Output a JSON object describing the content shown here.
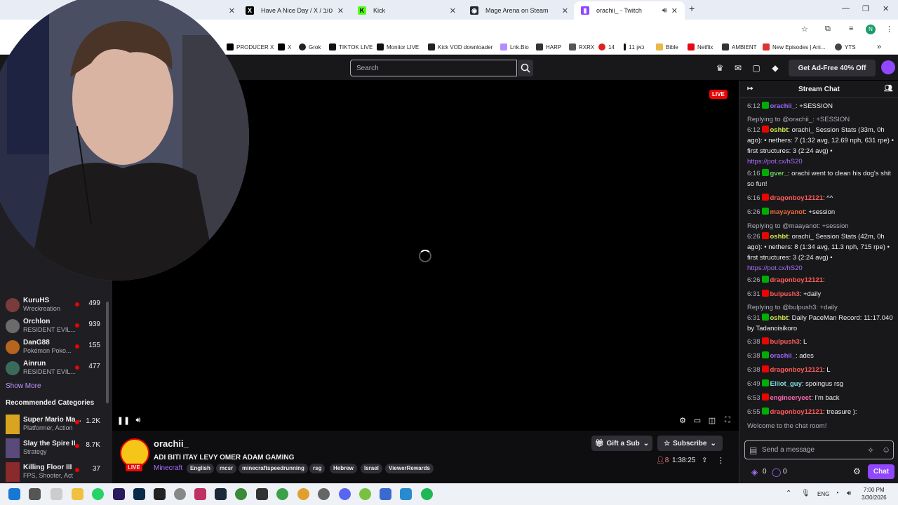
{
  "browser": {
    "tabs": [
      {
        "label": "",
        "icon": "blank-icon"
      },
      {
        "label": "Have A Nice Day / X / יום טוב",
        "icon": "x-icon"
      },
      {
        "label": "Kick",
        "icon": "kick-icon"
      },
      {
        "label": "Mage Arena on Steam",
        "icon": "steam-icon"
      },
      {
        "label": "orachii_ - Twitch",
        "icon": "twitch-icon"
      }
    ],
    "new_tab": "+",
    "bookmarks": [
      "PRODUCER X",
      "X",
      "Grok",
      "TIKTOK LIVE",
      "Monitor LIVE",
      "Kick VOD downloader",
      "Lnk.Bio",
      "HARP",
      "RXRX",
      "14",
      "כאן 11",
      "Bible",
      "Netflix",
      "AMBIENT",
      "New Episodes | Ani...",
      "YTS"
    ],
    "profile_initial": "N"
  },
  "twitch": {
    "search_placeholder": "Search",
    "adfree_label": "Get Ad-Free 40% Off"
  },
  "sidebar": {
    "channels": [
      {
        "name": "KuruHS",
        "game": "Wreckreation",
        "viewers": "499",
        "color": "#7a3b3b"
      },
      {
        "name": "Orchlon",
        "game": "RESIDENT EVIL...",
        "viewers": "939",
        "color": "#6b6b6b"
      },
      {
        "name": "DanG88",
        "game": "Pokémon Poko...",
        "viewers": "155",
        "color": "#b5651d"
      },
      {
        "name": "Ainrun",
        "game": "RESIDENT EVIL...",
        "viewers": "477",
        "color": "#3a6b5a"
      }
    ],
    "show_more": "Show More",
    "rec_heading": "Recommended Categories",
    "categories": [
      {
        "name": "Super Mario Ma...",
        "tags": "Platformer, Action",
        "viewers": "1.2K",
        "color": "#d9a520"
      },
      {
        "name": "Slay the Spire II",
        "tags": "Strategy",
        "viewers": "8.7K",
        "color": "#5a4a7a"
      },
      {
        "name": "Killing Floor III",
        "tags": "FPS, Shooter, Act",
        "viewers": "37",
        "color": "#8a2a2a"
      }
    ]
  },
  "player": {
    "live_badge": "LIVE"
  },
  "stream": {
    "streamer": "orachii_",
    "live": "LIVE",
    "title": "ADI BITI ITAY LEVY OMER ADAM GAMING",
    "game": "Minecraft",
    "tags": [
      "English",
      "mcsr",
      "minecraftspeedrunning",
      "rsg",
      "Hebrew",
      "Israel",
      "ViewerRewards"
    ],
    "gift_sub": "Gift a Sub",
    "subscribe": "Subscribe",
    "viewers": "8",
    "uptime": "1:38:25"
  },
  "chat": {
    "header": "Stream Chat",
    "messages": [
      {
        "reply": "",
        "time": "6:12",
        "user": "orachii_",
        "color": "#9b6bff",
        "text": ": +SESSION"
      },
      {
        "reply": "Replying to @orachii_: +SESSION",
        "time": "6:12",
        "user": "oshbt",
        "color": "#d0e84f",
        "text": ": orachi_ Session Stats (33m, 0h ago): • nethers: 7 (1:32 avg, 12.69 nph, 631 rpe) • first structures: 3 (2:24 avg) •",
        "link": "https://pot.cx/hS20"
      },
      {
        "reply": "",
        "time": "6:16",
        "user": "gver_",
        "color": "#6ad15a",
        "text": ": orachi went to clean his dog's shit so fun!"
      },
      {
        "reply": "",
        "time": "6:16",
        "user": "dragonboy12121",
        "color": "#ff5a5a",
        "text": ": ^^"
      },
      {
        "reply": "",
        "time": "6:26",
        "user": "mayayanot",
        "color": "#e86a3a",
        "text": ": +session"
      },
      {
        "reply": "Replying to @maayanot: +session",
        "time": "6:26",
        "user": "oshbt",
        "color": "#d0e84f",
        "text": ": orachi_ Session Stats (42m, 0h ago): • nethers: 8 (1:34 avg, 11.3 nph, 715 rpe) • first structures: 3 (2:24 avg) •",
        "link": "https://pot.cx/hS20"
      },
      {
        "reply": "",
        "time": "6:26",
        "user": "dragonboy12121",
        "color": "#ff5a5a",
        "text": ":"
      },
      {
        "reply": "",
        "time": "6:31",
        "user": "bulpush3",
        "color": "#ff5a5a",
        "text": ": +daily"
      },
      {
        "reply": "Replying to @bulpush3: +daily",
        "time": "6:31",
        "user": "oshbt",
        "color": "#d0e84f",
        "text": ": Daily PaceMan Record: 11:17.040 by Tadanoisikoro"
      },
      {
        "reply": "",
        "time": "6:38",
        "user": "bulpush3",
        "color": "#ff5a5a",
        "text": ": L"
      },
      {
        "reply": "",
        "time": "6:38",
        "user": "orachii_",
        "color": "#9b6bff",
        "text": ": ades"
      },
      {
        "reply": "",
        "time": "6:38",
        "user": "dragonboy12121",
        "color": "#ff5a5a",
        "text": ": L"
      },
      {
        "reply": "",
        "time": "6:49",
        "user": "Elliot_guy",
        "color": "#7fe0e8",
        "text": ": spoingus rsg"
      },
      {
        "reply": "",
        "time": "6:53",
        "user": "engineeryeet",
        "color": "#ff69b4",
        "text": ": I'm back"
      },
      {
        "reply": "",
        "time": "6:55",
        "user": "dragonboy12121",
        "color": "#ff5a5a",
        "text": ": treasure ):"
      }
    ],
    "welcome": "Welcome to the chat room!",
    "input_placeholder": "Send a message",
    "points_a": "0",
    "points_b": "0",
    "chat_button": "Chat"
  },
  "taskbar": {
    "lang": "ENG",
    "time": "7:00 PM",
    "date": "3/30/2026"
  }
}
